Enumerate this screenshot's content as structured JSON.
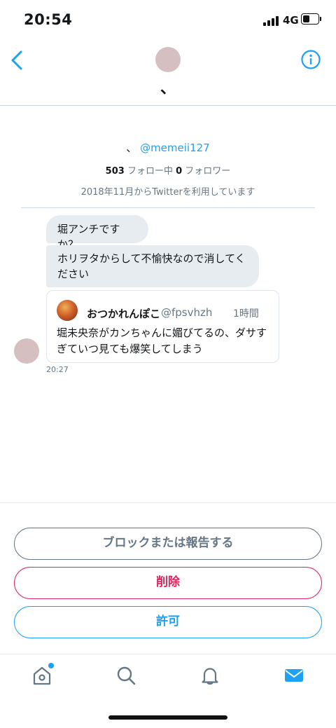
{
  "status": {
    "time": "20:54",
    "network": "4G"
  },
  "header": {
    "name": "、"
  },
  "profile": {
    "name": "、",
    "handle": "@memeii127",
    "following_count": "503",
    "following_label": "フォロー中",
    "followers_count": "0",
    "followers_label": "フォロワー",
    "joined": "2018年11月からTwitterを利用しています"
  },
  "messages": [
    {
      "text": "堀アンチですか？"
    },
    {
      "text": "ホリヲタからして不愉快なので消してください"
    }
  ],
  "quoted_tweet": {
    "name": "おつかれんぽこ",
    "handle": "@fpsvhzh",
    "time": "1時間",
    "text": "堀未央奈がカンちゃんに媚びてるの、ダサすぎていつ見ても爆笑してしまう"
  },
  "message_time": "20:27",
  "actions": {
    "block_report": "ブロックまたは報告する",
    "delete": "削除",
    "allow": "許可"
  },
  "colors": {
    "accent": "#1da1f2",
    "danger": "#e0245e",
    "muted": "#657786",
    "bubble": "#e6ecf0"
  },
  "icons": [
    "back-arrow-icon",
    "info-icon",
    "home-icon",
    "search-icon",
    "notifications-bell-icon",
    "messages-envelope-icon"
  ]
}
